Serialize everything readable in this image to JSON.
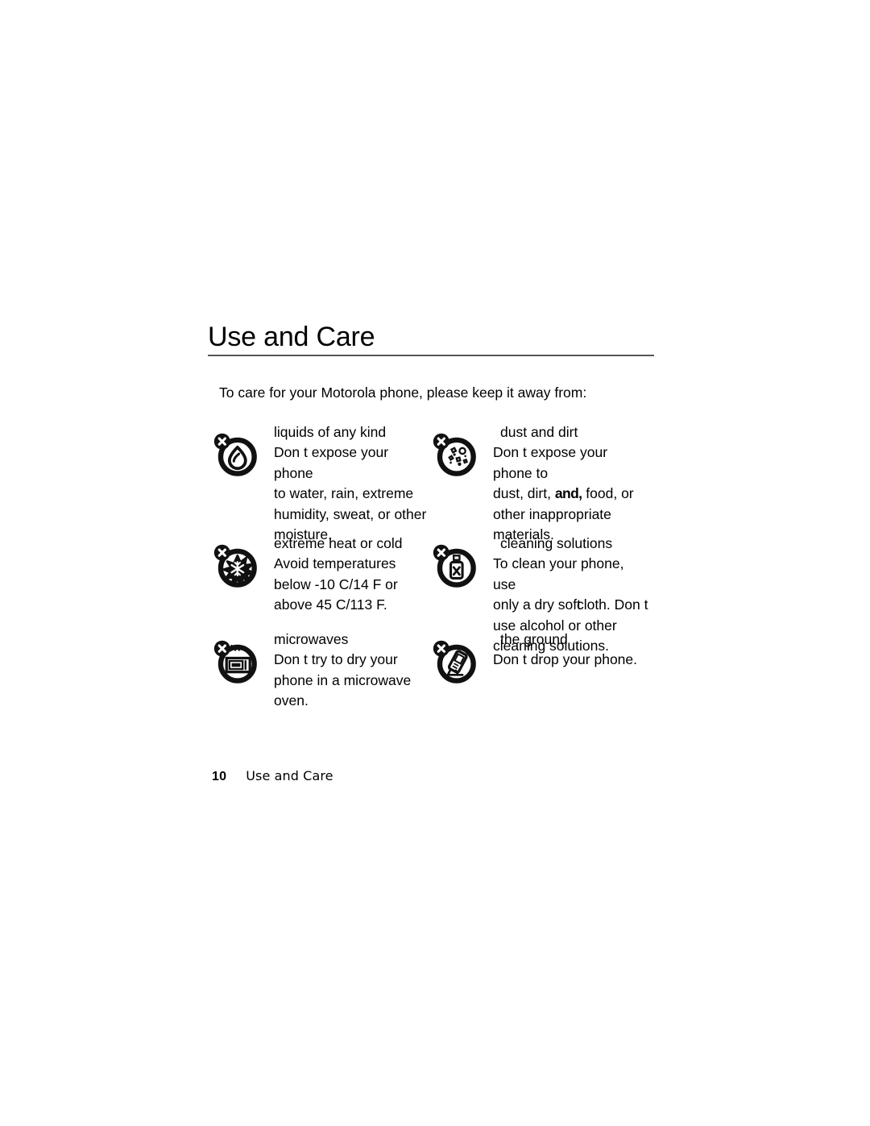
{
  "document": {
    "chapter_title": "Use and Care",
    "intro": "To care for your Motorola phone, please keep it away from:"
  },
  "care_items": {
    "liquids": {
      "icon": "no-liquids-icon",
      "heading": "liquids of any kind",
      "body_line1": "Don t expose your phone",
      "body_line2": "to water, rain, extreme",
      "body_line3": "humidity, sweat, or other",
      "body_line4": "moisture."
    },
    "dust": {
      "icon": "no-dust-and-dirt-icon",
      "heading": "dust and dirt",
      "body_line1": "Don t expose your phone to",
      "body_line2_a": "dust, dirt, ",
      "body_line2_b": "and,",
      "body_line2_c": " food, or",
      "body_line3": "other inappropriate",
      "body_line4": "materials."
    },
    "temperature": {
      "icon": "no-extreme-heat-or-cold-icon",
      "heading": "extreme heat or cold",
      "body_line1": "Avoid temperatures",
      "body_line2": "below -10 C/14 F or",
      "body_line3": "above 45 C/113 F."
    },
    "cleaning": {
      "icon": "no-cleaning-solutions-icon",
      "heading": "cleaning solutions",
      "body_line1": "To clean your phone, use",
      "body_line2_a": "only a dry soft",
      "body_line2_b": "cloth. Don t",
      "body_line3": "use alcohol or other",
      "body_line4": "cleaning solutions."
    },
    "microwaves": {
      "icon": "no-microwaves-icon",
      "heading": "microwaves",
      "body_line1": "Don t try to dry your",
      "body_line2": "phone in a microwave",
      "body_line3": "oven."
    },
    "ground": {
      "icon": "no-dropping-on-ground-icon",
      "heading": "the ground",
      "body_line1": "Don t drop your phone."
    }
  },
  "footer": {
    "page_number": "10",
    "section": "Use and Care"
  },
  "colors": {
    "text": "#000000",
    "rule": "#56565a",
    "background": "#ffffff"
  }
}
